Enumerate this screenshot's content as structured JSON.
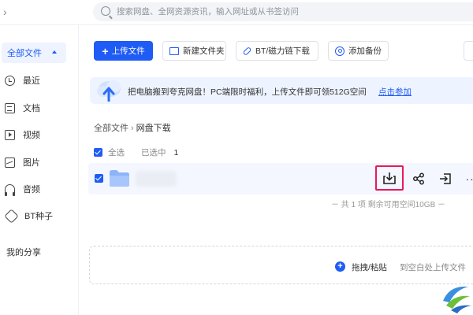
{
  "topbar": {
    "nav_arrow": "›"
  },
  "search": {
    "placeholder": "搜索网盘、全网资源资讯，输入网址或从书签访问"
  },
  "sidebar": {
    "all_files": "全部文件",
    "items": [
      {
        "label": "最近",
        "icon": "clock-icon"
      },
      {
        "label": "文档",
        "icon": "document-icon"
      },
      {
        "label": "视频",
        "icon": "video-icon"
      },
      {
        "label": "图片",
        "icon": "image-icon"
      },
      {
        "label": "音频",
        "icon": "headphones-icon"
      },
      {
        "label": "BT种子",
        "icon": "link-icon"
      }
    ],
    "my_share": "我的分享"
  },
  "toolbar": {
    "upload": "上传文件",
    "new_folder": "新建文件夹",
    "bt_download": "BT/磁力链下载",
    "add_backup": "添加备份"
  },
  "banner": {
    "text": "把电脑搬到夸克网盘！PC端限时福利，上传文件即可领512G空间",
    "link": "点击参加"
  },
  "breadcrumb": {
    "root": "全部文件",
    "separator": "›",
    "current": "网盘下载"
  },
  "selection": {
    "select_all": "全选",
    "selected_label": "已选中",
    "selected_count": "1"
  },
  "file_row": {
    "more": "···"
  },
  "footer": {
    "total": "－ 共 1 项 剩余可用空间10GB －"
  },
  "drop_zone": {
    "plus": "+",
    "label": "拖拽/粘贴",
    "hint": "到空白处上传文件"
  },
  "colors": {
    "primary": "#1f5cf6",
    "highlight_border": "#e8195a",
    "banner_bg": "#eef4ff"
  }
}
